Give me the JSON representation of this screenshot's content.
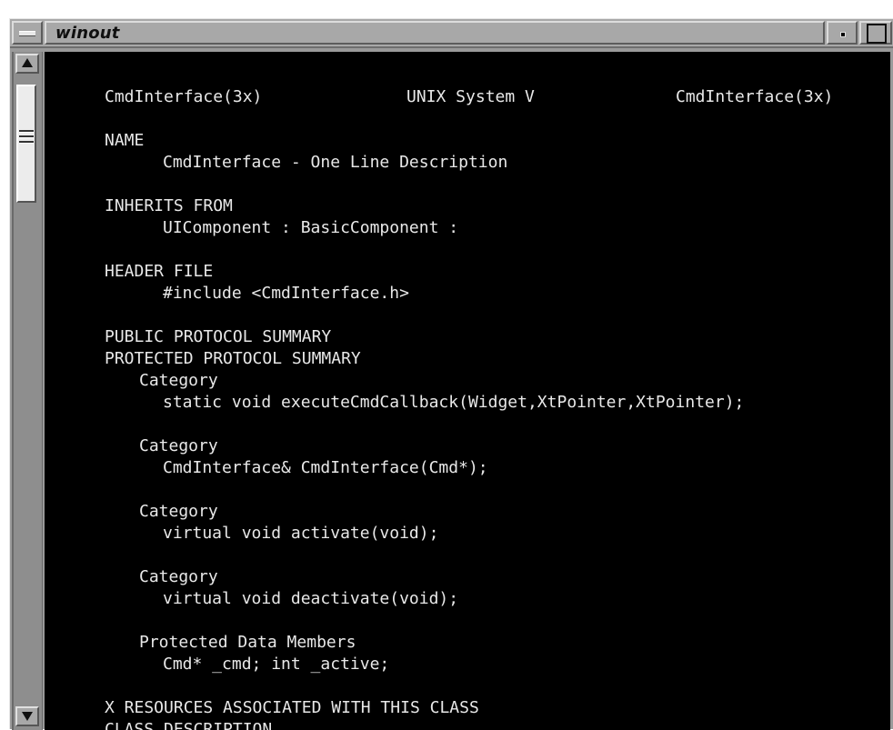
{
  "window": {
    "title": "winout"
  },
  "manpage": {
    "header_left": "CmdInterface(3x)",
    "header_center": "UNIX System V",
    "header_right": "CmdInterface(3x)",
    "name_heading": "NAME",
    "name_text": "CmdInterface - One Line Description",
    "inherits_heading": "INHERITS FROM",
    "inherits_text": "UIComponent : BasicComponent :",
    "header_file_heading": "HEADER FILE",
    "header_file_text": "#include <CmdInterface.h>",
    "public_summary_heading": "PUBLIC PROTOCOL SUMMARY",
    "protected_summary_heading": "PROTECTED PROTOCOL SUMMARY",
    "categories": [
      {
        "label": "Category",
        "signature": "static void executeCmdCallback(Widget,XtPointer,XtPointer);"
      },
      {
        "label": "Category",
        "signature": "CmdInterface& CmdInterface(Cmd*);"
      },
      {
        "label": "Category",
        "signature": "virtual void activate(void);"
      },
      {
        "label": "Category",
        "signature": "virtual void deactivate(void);"
      }
    ],
    "protected_members_label": "Protected Data Members",
    "protected_members_text": "Cmd* _cmd; int _active;",
    "x_resources_heading": "X RESOURCES ASSOCIATED WITH THIS CLASS",
    "class_description_heading": "CLASS DESCRIPTION"
  },
  "colors": {
    "terminal_bg": "#000000",
    "terminal_fg": "#e8e8e8",
    "chrome": "#a8a8a8"
  }
}
